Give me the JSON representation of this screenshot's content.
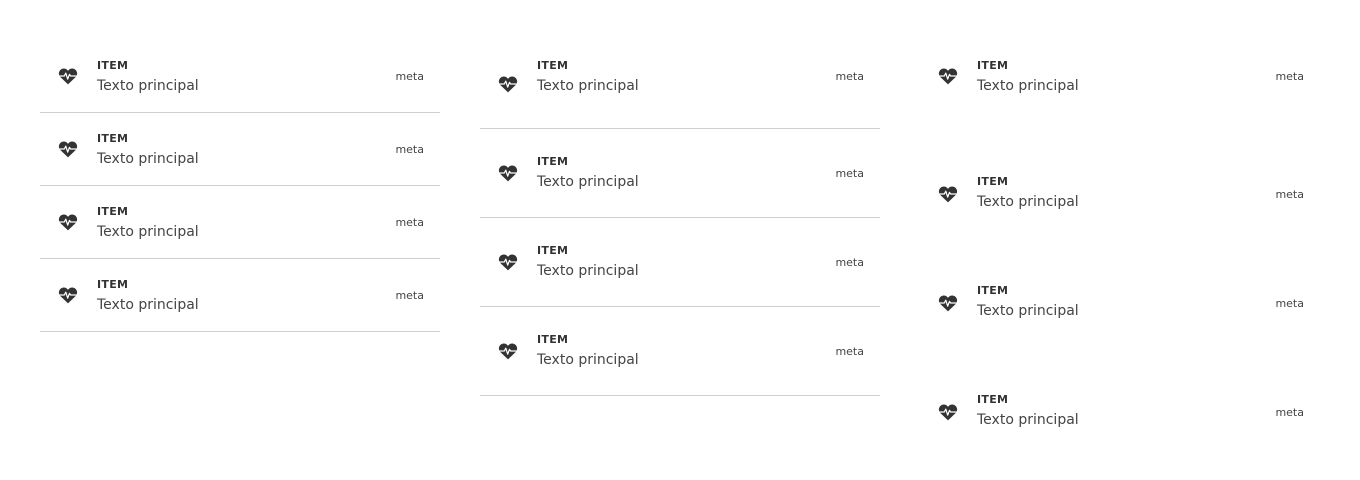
{
  "icons": {
    "item_icon": "heart-pulse-icon"
  },
  "lists": [
    {
      "items": [
        {
          "overline": "ITEM",
          "primary": "Texto principal",
          "meta": "meta"
        },
        {
          "overline": "ITEM",
          "primary": "Texto principal",
          "meta": "meta"
        },
        {
          "overline": "ITEM",
          "primary": "Texto principal",
          "meta": "meta"
        },
        {
          "overline": "ITEM",
          "primary": "Texto principal",
          "meta": "meta"
        }
      ]
    },
    {
      "items": [
        {
          "overline": "ITEM",
          "primary": "Texto principal",
          "meta": "meta"
        },
        {
          "overline": "ITEM",
          "primary": "Texto principal",
          "meta": "meta"
        },
        {
          "overline": "ITEM",
          "primary": "Texto principal",
          "meta": "meta"
        },
        {
          "overline": "ITEM",
          "primary": "Texto principal",
          "meta": "meta"
        }
      ]
    },
    {
      "items": [
        {
          "overline": "ITEM",
          "primary": "Texto principal",
          "meta": "meta"
        },
        {
          "overline": "ITEM",
          "primary": "Texto principal",
          "meta": "meta"
        },
        {
          "overline": "ITEM",
          "primary": "Texto principal",
          "meta": "meta"
        },
        {
          "overline": "ITEM",
          "primary": "Texto principal",
          "meta": "meta"
        }
      ]
    }
  ]
}
